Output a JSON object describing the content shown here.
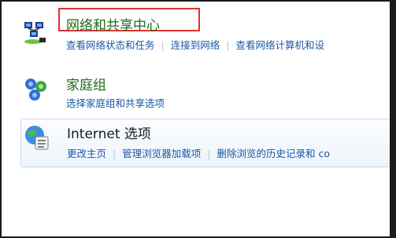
{
  "categories": {
    "network": {
      "title": "网络和共享中心",
      "icon": "network-center-icon",
      "links": [
        "查看网络状态和任务",
        "连接到网络",
        "查看网络计算机和设"
      ]
    },
    "homegroup": {
      "title": "家庭组",
      "icon": "homegroup-icon",
      "links": [
        "选择家庭组和共享选项"
      ]
    },
    "internet_options": {
      "title": "Internet 选项",
      "icon": "internet-options-icon",
      "links": [
        "更改主页",
        "管理浏览器加载项",
        "删除浏览的历史记录和 co"
      ]
    }
  },
  "colors": {
    "title_green": "#1e6a16",
    "link_blue": "#1a57a6",
    "highlight_red": "#e03131"
  }
}
